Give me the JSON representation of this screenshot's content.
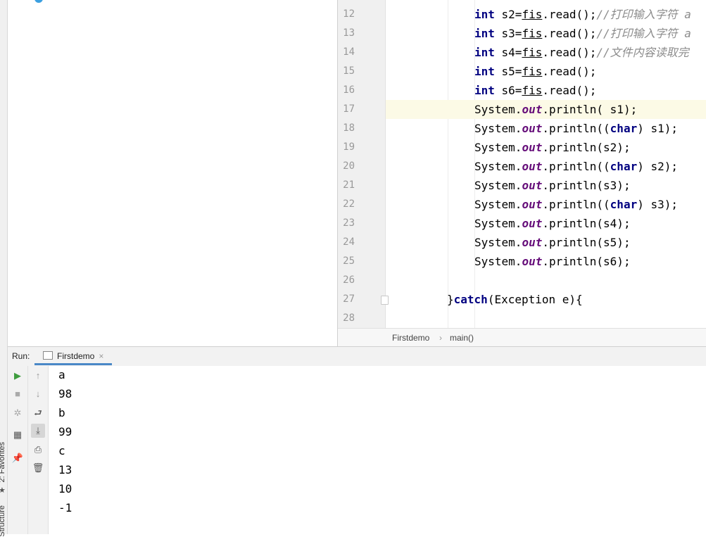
{
  "left_strip": {
    "favorites_label": "2: Favorites",
    "structure_label": "Structure"
  },
  "editor": {
    "current_line": 17,
    "lines": [
      {
        "n": "12",
        "tokens": [
          [
            "kw",
            "int"
          ],
          [
            "t",
            " s2="
          ],
          [
            "ul",
            "fis"
          ],
          [
            "t",
            ".read();"
          ],
          [
            "cmt",
            "//打印输入字符 a"
          ]
        ]
      },
      {
        "n": "13",
        "tokens": [
          [
            "kw",
            "int"
          ],
          [
            "t",
            " s3="
          ],
          [
            "ul",
            "fis"
          ],
          [
            "t",
            ".read();"
          ],
          [
            "cmt",
            "//打印输入字符 a"
          ]
        ]
      },
      {
        "n": "14",
        "tokens": [
          [
            "kw",
            "int"
          ],
          [
            "t",
            " s4="
          ],
          [
            "ul",
            "fis"
          ],
          [
            "t",
            ".read();"
          ],
          [
            "cmt",
            "//文件内容读取完"
          ]
        ]
      },
      {
        "n": "15",
        "tokens": [
          [
            "kw",
            "int"
          ],
          [
            "t",
            " s5="
          ],
          [
            "ul",
            "fis"
          ],
          [
            "t",
            ".read();"
          ]
        ]
      },
      {
        "n": "16",
        "tokens": [
          [
            "kw",
            "int"
          ],
          [
            "t",
            " s6="
          ],
          [
            "ul",
            "fis"
          ],
          [
            "t",
            ".read();"
          ]
        ]
      },
      {
        "n": "17",
        "tokens": [
          [
            "t",
            "System."
          ],
          [
            "field",
            "out"
          ],
          [
            "t",
            ".println( s1);"
          ]
        ]
      },
      {
        "n": "18",
        "tokens": [
          [
            "t",
            "System."
          ],
          [
            "field",
            "out"
          ],
          [
            "t",
            ".println(("
          ],
          [
            "kw",
            "char"
          ],
          [
            "t",
            ") s1);"
          ]
        ]
      },
      {
        "n": "19",
        "tokens": [
          [
            "t",
            "System."
          ],
          [
            "field",
            "out"
          ],
          [
            "t",
            ".println(s2);"
          ]
        ]
      },
      {
        "n": "20",
        "tokens": [
          [
            "t",
            "System."
          ],
          [
            "field",
            "out"
          ],
          [
            "t",
            ".println(("
          ],
          [
            "kw",
            "char"
          ],
          [
            "t",
            ") s2);"
          ]
        ]
      },
      {
        "n": "21",
        "tokens": [
          [
            "t",
            "System."
          ],
          [
            "field",
            "out"
          ],
          [
            "t",
            ".println(s3);"
          ]
        ]
      },
      {
        "n": "22",
        "tokens": [
          [
            "t",
            "System."
          ],
          [
            "field",
            "out"
          ],
          [
            "t",
            ".println(("
          ],
          [
            "kw",
            "char"
          ],
          [
            "t",
            ") s3);"
          ]
        ]
      },
      {
        "n": "23",
        "tokens": [
          [
            "t",
            "System."
          ],
          [
            "field",
            "out"
          ],
          [
            "t",
            ".println(s4);"
          ]
        ]
      },
      {
        "n": "24",
        "tokens": [
          [
            "t",
            "System."
          ],
          [
            "field",
            "out"
          ],
          [
            "t",
            ".println(s5);"
          ]
        ]
      },
      {
        "n": "25",
        "tokens": [
          [
            "t",
            "System."
          ],
          [
            "field",
            "out"
          ],
          [
            "t",
            ".println(s6);"
          ]
        ]
      },
      {
        "n": "26",
        "tokens": []
      },
      {
        "n": "27",
        "tokens": [
          [
            "t",
            "}"
          ],
          [
            "kw",
            "catch"
          ],
          [
            "t",
            "(Exception e){"
          ]
        ]
      },
      {
        "n": "28",
        "tokens": []
      }
    ]
  },
  "breadcrumb": {
    "class_name": "Firstdemo",
    "separator": "›",
    "method_name": "main()"
  },
  "run_panel": {
    "label": "Run:",
    "tab_name": "Firstdemo",
    "tab_close": "×",
    "output": [
      "a",
      "98",
      "b",
      "99",
      "c",
      "13",
      "10",
      "-1"
    ]
  },
  "toolbar_left": [
    {
      "name": "rerun-icon",
      "glyph": "▶"
    },
    {
      "name": "stop-icon",
      "glyph": "■"
    },
    {
      "name": "debug-settings-icon",
      "glyph": "✲"
    },
    {
      "name": "layout-icon",
      "glyph": "▦"
    },
    {
      "name": "pin-icon",
      "glyph": "📌"
    }
  ],
  "toolbar_right": [
    {
      "name": "up-arrow-icon",
      "glyph": "↑"
    },
    {
      "name": "down-arrow-icon",
      "glyph": "↓"
    },
    {
      "name": "soft-wrap-icon",
      "glyph": "⮐"
    },
    {
      "name": "scroll-to-end-icon",
      "glyph": "⤓"
    },
    {
      "name": "print-icon",
      "glyph": "⎙"
    },
    {
      "name": "trash-icon",
      "glyph": "🗑"
    }
  ],
  "colors": {
    "run_green": "#3e9c3e",
    "keyword": "#000080",
    "field": "#660e7a",
    "comment": "#8c8c8c",
    "current_line": "#fcfae6"
  }
}
